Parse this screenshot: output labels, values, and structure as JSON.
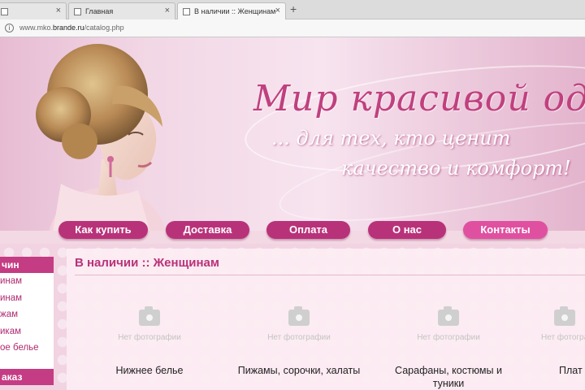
{
  "browser": {
    "tabs": [
      {
        "label": ""
      },
      {
        "label": "Главная"
      },
      {
        "label": "В наличии :: Женщинам"
      }
    ],
    "new_tab": "+",
    "close_glyph": "×",
    "address": {
      "prefix": "www.mko.",
      "domain": "brande.ru",
      "path": "/catalog.php"
    }
  },
  "banner": {
    "title": "Мир красивой одежды",
    "subtitle_line1": "... для тех, кто ценит",
    "subtitle_line2": "качество и комфорт!"
  },
  "nav": {
    "items": [
      {
        "label": "Как купить"
      },
      {
        "label": "Доставка"
      },
      {
        "label": "Оплата"
      },
      {
        "label": "О нас"
      },
      {
        "label": "Контакты"
      }
    ]
  },
  "sidebar": {
    "heading": "чин",
    "items": [
      "инам",
      "инам",
      "жам",
      "икам",
      "ое белье"
    ],
    "heading2": "аказ"
  },
  "main": {
    "title": "В наличии :: Женщинам",
    "no_photo": "Нет фотографии",
    "cards": [
      {
        "title": "Нижнее белье"
      },
      {
        "title": "Пижамы, сорочки, халаты"
      },
      {
        "title": "Сарафаны, костюмы и туники"
      },
      {
        "title": "Плат"
      }
    ]
  },
  "colors": {
    "accent": "#b8327a",
    "accent_alt": "#e050a0",
    "banner": "#f2d7e5"
  },
  "icons": [
    "page-icon",
    "info-icon",
    "camera-icon"
  ]
}
